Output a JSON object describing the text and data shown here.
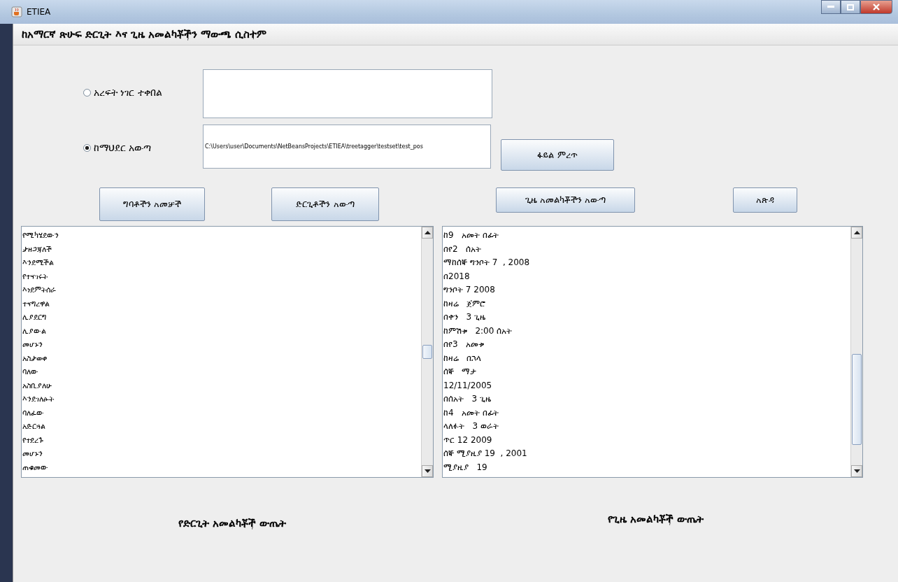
{
  "window": {
    "title": "ETIEA"
  },
  "heading": "ከአማርኛ ጽሁፍ ድርጊት እና ጊዜ አመልካቾችን ማውጫ ሲስተም",
  "input_options": [
    {
      "label": "አረፍት ነገር ተቀበል",
      "selected": false,
      "kind": "textarea"
    },
    {
      "label": "ከማህደር አውጣ",
      "selected": true,
      "kind": "path",
      "value": "C:\\Users\\user\\Documents\\NetBeansProjects\\ETIEA\\treetagger\\testset\\test_pos",
      "button": "ፋይል ምረጥ"
    }
  ],
  "action_buttons": [
    "ግባቶችን አመቻች",
    "ድርጊቶችን አውጣ",
    "ጊዜ አመልካቾችን አውጣ",
    "አጽዳ"
  ],
  "action_lists": [
    "የሚካሄደውን",
    "ታዘጋጃለች",
    "እንደሚችል",
    "የተናገሩት",
    "እነደምትሰራ",
    "ተናግረዋል",
    "ሊያደርግ",
    "ሊያውል",
    "መሆኑን",
    "አስታወቀ",
    "ባለው",
    "አስቢያለሁ",
    "እንደገለፁት",
    "ባለፈው",
    "አድርጓል",
    "የተደረጉ",
    "መሆኑን",
    "ጠቁመው"
  ],
  "time_list": [
    "ከ9   አመት በፊት",
    "በየ2   ሰአት",
    "ማከሰኞ ግንቦት 7  , 2008",
    "በ2018",
    "ግንቦት 7 2008",
    "ከዛሬ   ጀምሮ",
    "በቀን   3 ጊዜ",
    "ከምሽቱ   2:00 ሰአት",
    "በየ3   አመቱ",
    "ከዛሬ   በኋላ",
    "ሰኞ   ማታ",
    "12/11/2005",
    "በሰአት   3 ጊዜ",
    "ከ4   አመት በፊት",
    "ላለፉት   3 ወራት",
    "ጥር 12 2009",
    "ሰኞ ሚያዚያ 19  , 2001",
    "ሚያዚያ   19"
  ],
  "footer_labels": [
    "የድርጊት አመልካቾች ውጤት",
    "የጊዜ አመልካቾች ውጤት"
  ]
}
